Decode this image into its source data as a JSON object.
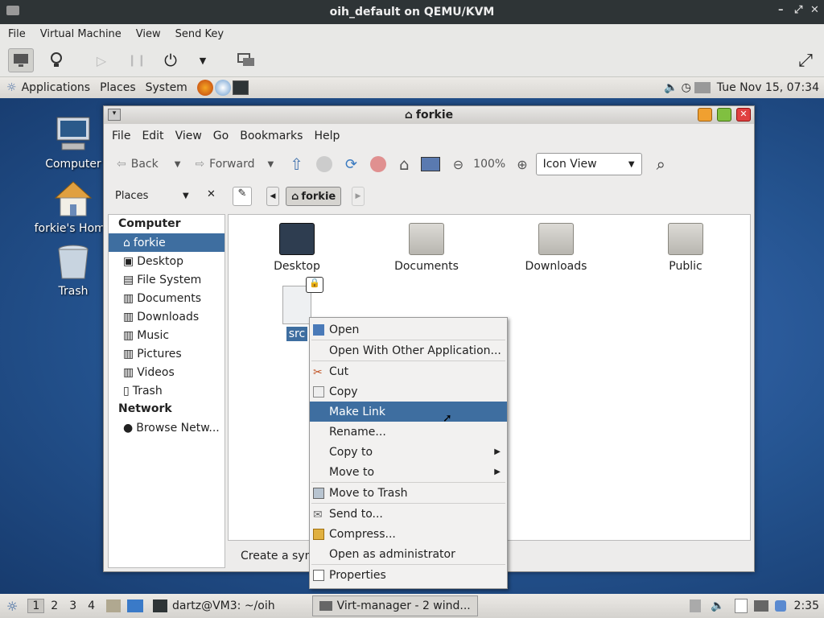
{
  "host": {
    "title": "oih_default on QEMU/KVM",
    "menu": [
      "File",
      "Virtual Machine",
      "View",
      "Send Key"
    ]
  },
  "panel": {
    "menus": [
      "Applications",
      "Places",
      "System"
    ],
    "clock": "Tue Nov 15, 07:34"
  },
  "desktop": {
    "icons": [
      "Computer",
      "forkie's Home",
      "Trash"
    ]
  },
  "nautilus": {
    "title": "forkie",
    "menu": [
      "File",
      "Edit",
      "View",
      "Go",
      "Bookmarks",
      "Help"
    ],
    "back": "Back",
    "forward": "Forward",
    "zoom": "100%",
    "view_mode": "Icon View",
    "places_label": "Places",
    "path": "forkie",
    "sidebar": {
      "computer_header": "Computer",
      "computer_items": [
        "forkie",
        "Desktop",
        "File System",
        "Documents",
        "Downloads",
        "Music",
        "Pictures",
        "Videos",
        "Trash"
      ],
      "network_header": "Network",
      "network_items": [
        "Browse Netw..."
      ]
    },
    "files": [
      "Desktop",
      "Documents",
      "Downloads",
      "Public",
      "src"
    ],
    "status": "Create a sym"
  },
  "context_menu": {
    "items": [
      "Open",
      "Open With Other Application...",
      "Cut",
      "Copy",
      "Make Link",
      "Rename...",
      "Copy to",
      "Move to",
      "Move to Trash",
      "Send to...",
      "Compress...",
      "Open as administrator",
      "Properties"
    ]
  },
  "taskbar": {
    "workspaces": [
      "1",
      "2",
      "3",
      "4"
    ],
    "terminal": "dartz@VM3: ~/oih",
    "virt": "Virt-manager - 2 wind...",
    "time": "2:35"
  }
}
